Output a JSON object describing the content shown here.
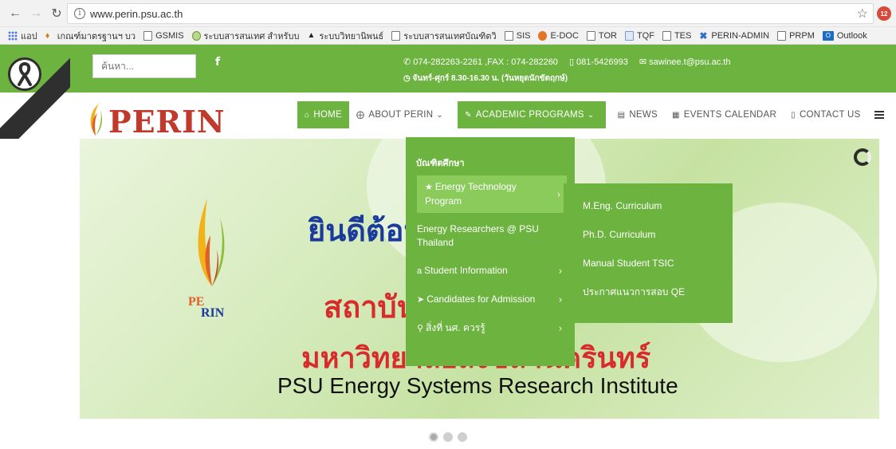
{
  "browser": {
    "back_icon": "arrow-left-icon",
    "forward_icon": "arrow-right-icon",
    "reload_icon": "reload-icon",
    "url": "www.perin.psu.ac.th",
    "extension_badge": "12"
  },
  "bookmarks": [
    {
      "label": "แอป",
      "icon": "apps-icon"
    },
    {
      "label": "เกณฑ์มาตรฐานฯ บว",
      "icon": "flame-icon"
    },
    {
      "label": "GSMIS",
      "icon": "page-icon"
    },
    {
      "label": "ระบบสารสนเทศ สำหรับบ",
      "icon": "globe-icon"
    },
    {
      "label": "ระบบวิทยานิพนธ์",
      "icon": "graduation-cap-icon"
    },
    {
      "label": "ระบบสารสนเทศบัณฑิตวิ",
      "icon": "page-icon"
    },
    {
      "label": "SIS",
      "icon": "page-icon"
    },
    {
      "label": "E-DOC",
      "icon": "firefox-icon"
    },
    {
      "label": "TOR",
      "icon": "page-icon"
    },
    {
      "label": "TQF",
      "icon": "document-icon"
    },
    {
      "label": "TES",
      "icon": "page-icon"
    },
    {
      "label": "PERIN-ADMIN",
      "icon": "x-icon"
    },
    {
      "label": "PRPM",
      "icon": "page-icon"
    },
    {
      "label": "Outlook",
      "icon": "outlook-icon"
    }
  ],
  "topbar": {
    "search_placeholder": "ค้นหา...",
    "facebook": "f",
    "phone": "074-282263-2261 ,FAX : 074-282260",
    "mobile": "081-5426993",
    "email": "sawinee.t@psu.ac.th",
    "hours": "จันทร์-ศุกร์ 8.30-16.30 น. (วันหยุดนักขัตฤกษ์)"
  },
  "logo": {
    "text": "PERIN",
    "small_text": "PE RIN"
  },
  "menu": [
    {
      "label": "HOME",
      "icon": "home-icon",
      "active": true
    },
    {
      "label": "ABOUT PERIN",
      "icon": "globe-icon",
      "dropdown": true
    },
    {
      "label": "ACADEMIC PROGRAMS",
      "icon": "book-icon",
      "dropdown": true,
      "active": true
    },
    {
      "label": "NEWS",
      "icon": "newspaper-icon"
    },
    {
      "label": "EVENTS CALENDAR",
      "icon": "calendar-icon"
    },
    {
      "label": "CONTACT US",
      "icon": "phone-icon"
    }
  ],
  "dropdown": {
    "heading": "บัณฑิตศึกษา",
    "items": [
      {
        "label": "Energy Technology Program",
        "icon": "star-icon",
        "highlighted": true
      },
      {
        "label": "Energy Researchers @ PSU Thailand"
      },
      {
        "label": "Student Information",
        "icon": "amazon-icon"
      },
      {
        "label": "Candidates for Admission",
        "icon": "paper-plane-icon"
      },
      {
        "label": "สิ่งที่ นศ. ควรรู้",
        "icon": "search-icon"
      }
    ],
    "arrow": "›"
  },
  "submenu": {
    "items": [
      "M.Eng. Curriculum",
      "Ph.D. Curriculum",
      "Manual Student TSIC",
      "ประกาศแนวการสอบ QE"
    ]
  },
  "banner": {
    "welcome": "ยินดีต้อนรับสู่",
    "institute_th_1": "สถาบันวิจัยระบบพลังงาน",
    "institute_th_2": "มหาวิทยาลัยสงขลานครินทร์",
    "institute_en": "PSU Energy Systems Research Institute",
    "logo_text_1": "PE",
    "logo_text_2": "RIN"
  },
  "slider": {
    "count": 3,
    "active": 1
  },
  "colors": {
    "brand_green": "#6db33f",
    "highlight_green": "#8bcb5c",
    "title_blue": "#1a3a9c",
    "title_red": "#d92b2b"
  }
}
